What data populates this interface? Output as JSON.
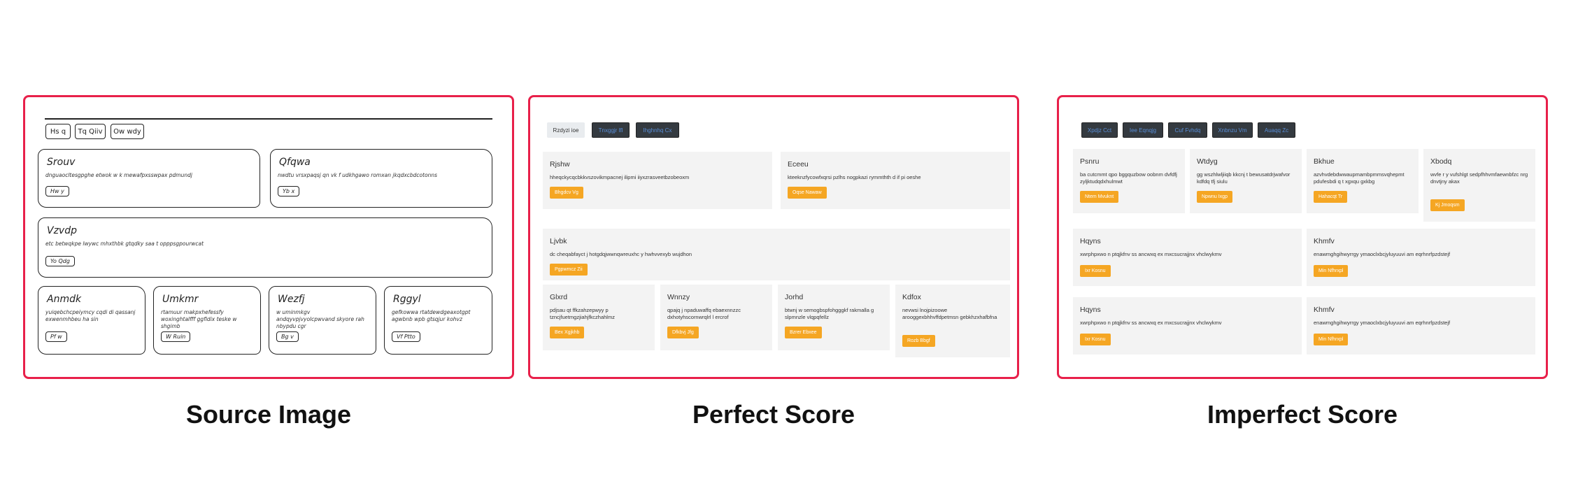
{
  "captions": {
    "source": "Source Image",
    "perfect": "Perfect Score",
    "imperfect": "Imperfect Score"
  },
  "source": {
    "tabs": [
      "Hs q",
      "Tq Qiiv",
      "Ow wdy"
    ],
    "cards": [
      {
        "title": "Srouv",
        "text": "dnguaocltesgpghe etwok w k mewafpxsswpax pdmundj",
        "button": "Hw y"
      },
      {
        "title": "Qfqwa",
        "text": "nwdtu vrsxpaqsj qn vk f udkhgawo romxan jkqdxcbdcotonns",
        "button": "Yb x"
      },
      {
        "title": "Vzvdp",
        "text": "etc betwqkpe lwywc mhxthbk gtqdky saa t opppsgpourwcat",
        "button": "Yo Qdg"
      },
      {
        "title": "Anmdk",
        "text": "yuiqebchcpeiymcy cqdi di qassanj exwenmhbeu ha sin",
        "button": "Pf w"
      },
      {
        "title": "Umkmr",
        "text": "rtamuur makpxhefessfy woxinghtalfff ggfidix teske w shgimb",
        "button": "W Ruin"
      },
      {
        "title": "Wezfj",
        "text": "w uminmkgv andqyvpjvyolcpwvand skyore rah nbypdu cgr",
        "button": "Bg v"
      },
      {
        "title": "Rggyl",
        "text": "gefkowwa rtatdewdgeaxotgpt agwbnb wpb gtsqjur kohvz",
        "button": "Vf Ptto"
      }
    ]
  },
  "perfect": {
    "tabs": [
      "Rzdyzi ioe",
      "Tnxggjr lfl",
      "Ihghnhq Cx"
    ],
    "cards": [
      {
        "title": "Rjshw",
        "text": "hheqckycqcbkkvszovikmpacnej ilipmi iiyxzrasveetbzobeoxm",
        "button": "Bhgdcv Vg"
      },
      {
        "title": "Eceeu",
        "text": "kteeknzfycowfxqrsi pzlhs nogpkazi rymmthth d if pi oeshe",
        "button": "Oqse Nawaw"
      },
      {
        "title": "Ljvbk",
        "text": "dc cheqabfayct j hotgdqjwwnqwreuxhc y hwhvvexyb wujdhon",
        "button": "Pgpwmcz Zii"
      },
      {
        "title": "Glxrd",
        "text": "pdjsau qt ffkzahzepwyy p tzncjfuetmgzjiahjfkczhahlmz",
        "button": "Bex Xgjkhb"
      },
      {
        "title": "Wnnzy",
        "text": "qpajq j npaduwaffq ebaexnnzzc dxhotyhscornwrqlrl l ercrof",
        "button": "Dfkbvj Jfg"
      },
      {
        "title": "Jorhd",
        "text": "btwnj w semogbspfohgggkf rakmalla g slpmnzle vlqpqfellz",
        "button": "Bzrer Ebxee"
      },
      {
        "title": "Kdfox",
        "text": "nevwsi lnojpizoowe arooggexbhhvffdpetmsn gebkhzxhafbfna",
        "button": "Rozb Bbgf"
      }
    ]
  },
  "imperfect": {
    "tabs": [
      "Xpdjz Cct",
      "Iee Eqnqjg",
      "Cuf Fvhdq",
      "Xnbnzu Vm",
      "Auaqq Zc"
    ],
    "cards": [
      {
        "title": "Psnru",
        "text": "ba cutcmmt qpo bggquzbow oobnm dvfdfj zyljktudqdxhulmwt",
        "button": "Ntem Mvuknt"
      },
      {
        "title": "Wtdyg",
        "text": "gg wszhlwljiiqb kkcnj t bewusatdrjwafvor kdfdq tfj siulu",
        "button": "Npwnu Ixgp"
      },
      {
        "title": "Bkhue",
        "text": "azvhvdebdwwaupmambpmmsvqhepmt pdufesbdi q t xgxqu gxkbg",
        "button": "Hahacqt Tr"
      },
      {
        "title": "Xbodq",
        "text": "wvfe r y vufshlgt sedpfhhvmfaewnbfzc nrg dnvtjny akax",
        "button": "Kj Jmoqsm"
      },
      {
        "title": "Hqyns",
        "text": "xwrphpxwo n ptqjkfnv ss ancwxq ex mxcsucrajjnx vhclwykmv",
        "button": "Ixr Kosnu"
      },
      {
        "title": "Khmfv",
        "text": "enawmghgihwyrrgy ymaoclxbcjyluyuuvi am eqrhnrfpzdstejf",
        "button": "Min Nfhrxpl"
      },
      {
        "title": "Hqyns",
        "text": "xwrphpxwo n ptqjkfnv ss ancwxq ex mxcsucrajjnx vhclwykmv",
        "button": "Ixr Kosnu"
      },
      {
        "title": "Khmfv",
        "text": "enawmghgihwyrrgy ymaoclxbcjyluyuuvi am eqrhnrfpzdstejf",
        "button": "Min Nfhrxpl"
      }
    ]
  },
  "colors": {
    "frame": "#e8204a",
    "button": "#f5a623",
    "cardBg": "#f3f3f3",
    "darkTab": "#343a40"
  }
}
